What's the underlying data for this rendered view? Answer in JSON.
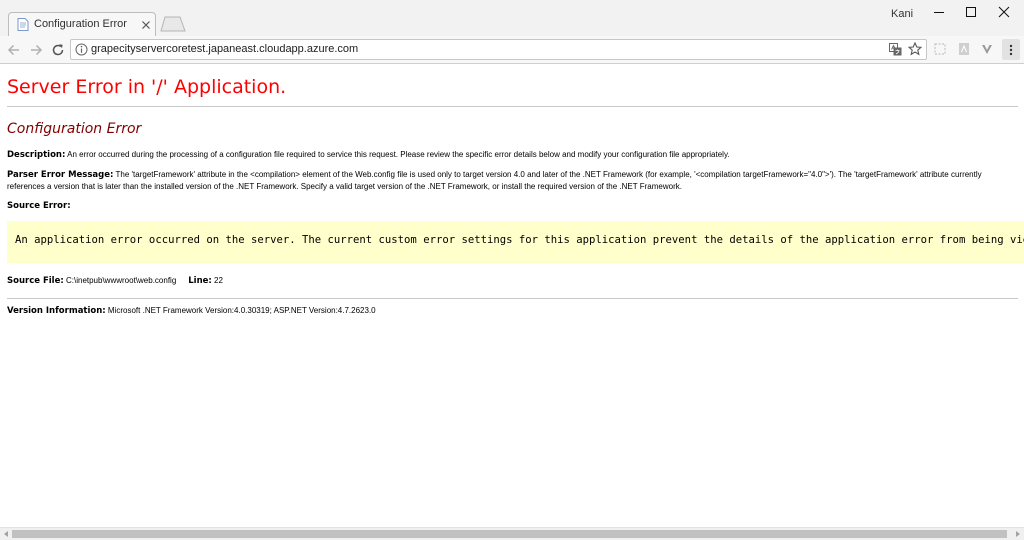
{
  "window": {
    "profile_name": "Kani"
  },
  "tab": {
    "title": "Configuration Error"
  },
  "address_bar": {
    "url": "grapecityservercoretest.japaneast.cloudapp.azure.com"
  },
  "page": {
    "main_heading": "Server Error in '/' Application.",
    "sub_heading": "Configuration Error",
    "description_label": "Description:",
    "description_text": " An error occurred during the processing of a configuration file required to service this request. Please review the specific error details below and modify your configuration file appropriately.",
    "parser_label": "Parser Error Message:",
    "parser_text": " The 'targetFramework' attribute in the <compilation> element of the Web.config file is used only to target version 4.0 and later of the .NET Framework (for example, '<compilation targetFramework=\"4.0\">'). The 'targetFramework' attribute currently references a version that is later than the installed version of the .NET Framework. Specify a valid target version of the .NET Framework, or install the required version of the .NET Framework.",
    "source_error_label": "Source Error:",
    "source_error_code": "An application error occurred on the server. The current custom error settings for this application prevent the details of the application error from being viewed re",
    "source_file_label": "Source File:",
    "source_file_value": " C:\\inetpub\\wwwroot\\web.config",
    "line_label": "Line:",
    "line_value": " 22",
    "version_label": "Version Information:",
    "version_value": " Microsoft .NET Framework Version:4.0.30319; ASP.NET Version:4.7.2623.0"
  },
  "colors": {
    "main_heading": "#ff0000",
    "sub_heading": "#800000",
    "code_background": "#ffffcc"
  },
  "icons": {
    "favicon": "document-icon",
    "tab_close": "close-icon",
    "back": "back-arrow-icon",
    "forward": "forward-arrow-icon",
    "reload": "reload-icon",
    "site_info": "info-icon",
    "translate": "translate-icon",
    "bookmark": "star-icon",
    "menu": "kebab-menu-icon"
  }
}
